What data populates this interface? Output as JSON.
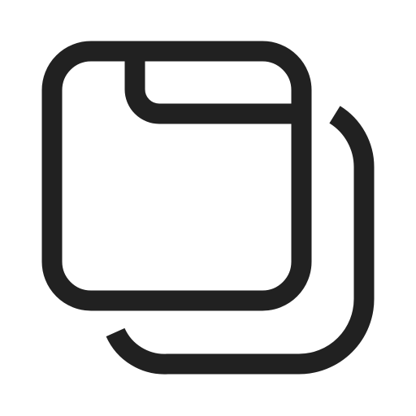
{
  "icon": {
    "name": "copy-tab-icon",
    "stroke_color": "#212121",
    "background_color": "#ffffff"
  }
}
